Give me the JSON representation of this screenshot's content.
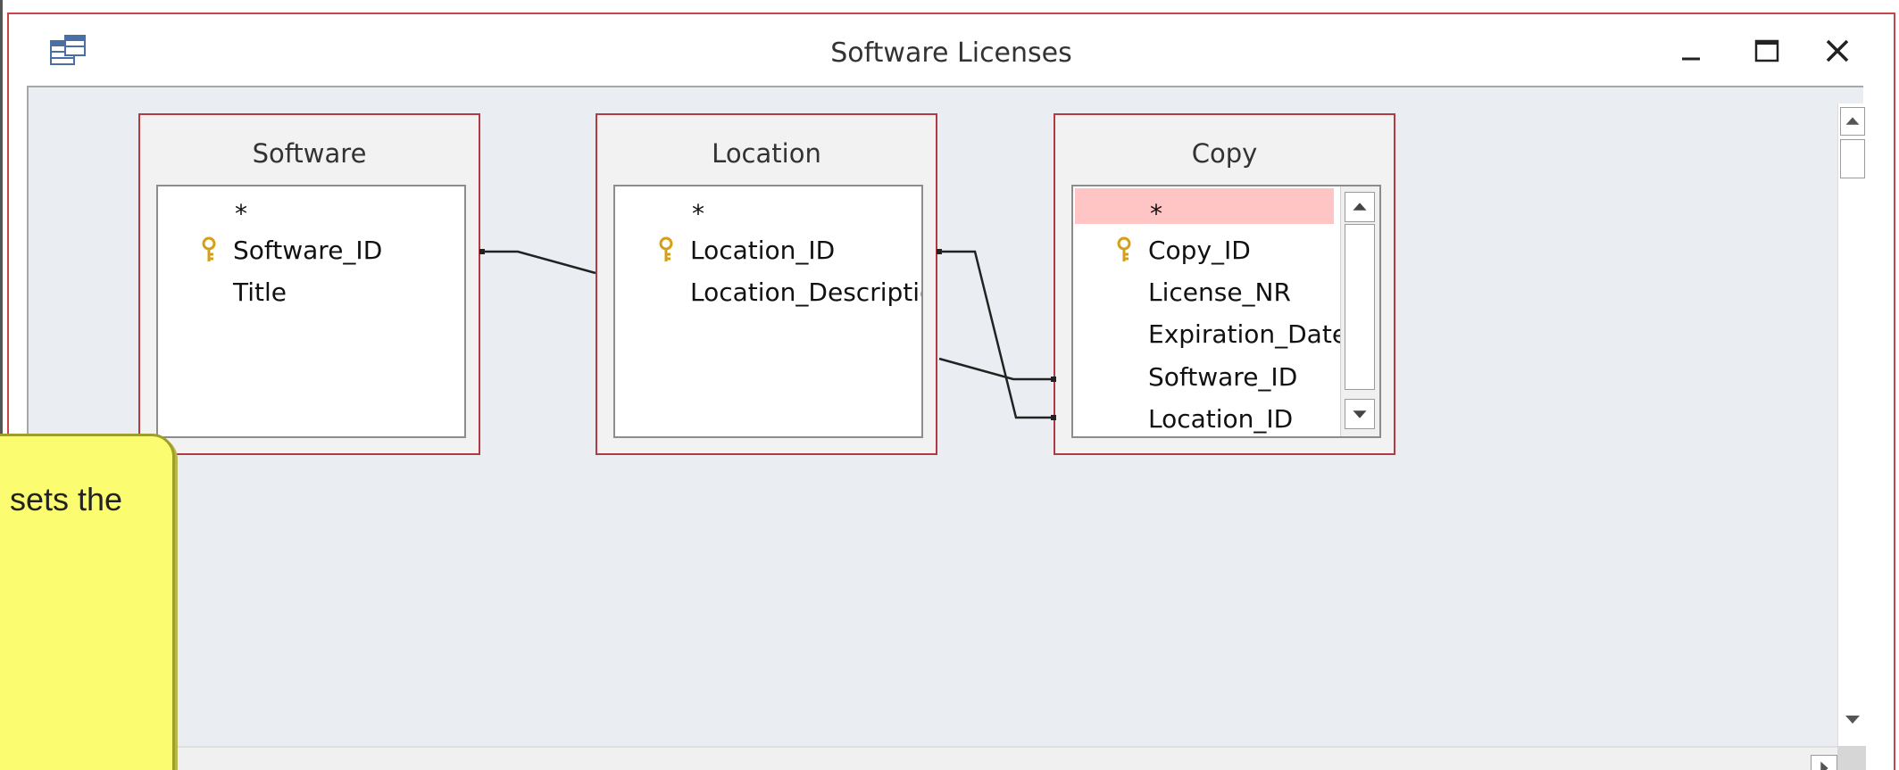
{
  "window": {
    "title": "Software Licenses"
  },
  "tables": {
    "software": {
      "title": "Software",
      "fields": [
        "*",
        "Software_ID",
        "Title"
      ]
    },
    "location": {
      "title": "Location",
      "fields": [
        "*",
        "Location_ID",
        "Location_Descriptio"
      ]
    },
    "copy": {
      "title": "Copy",
      "fields": [
        "*",
        "Copy_ID",
        "License_NR",
        "Expiration_Date",
        "Software_ID",
        "Location_ID"
      ]
    }
  },
  "callout": {
    "text": "sets the"
  },
  "colors": {
    "window_border": "#c8464a",
    "table_border": "#b23b41",
    "canvas": "#eaeef2",
    "selected_row": "#ffc4c4",
    "callout_fill": "#fcfc70",
    "key_icon": "#d4a017"
  },
  "icons": {
    "app": "table-design-icon",
    "minimize": "minimize-icon",
    "maximize": "maximize-icon",
    "close": "close-icon",
    "primary_key": "key-icon"
  }
}
